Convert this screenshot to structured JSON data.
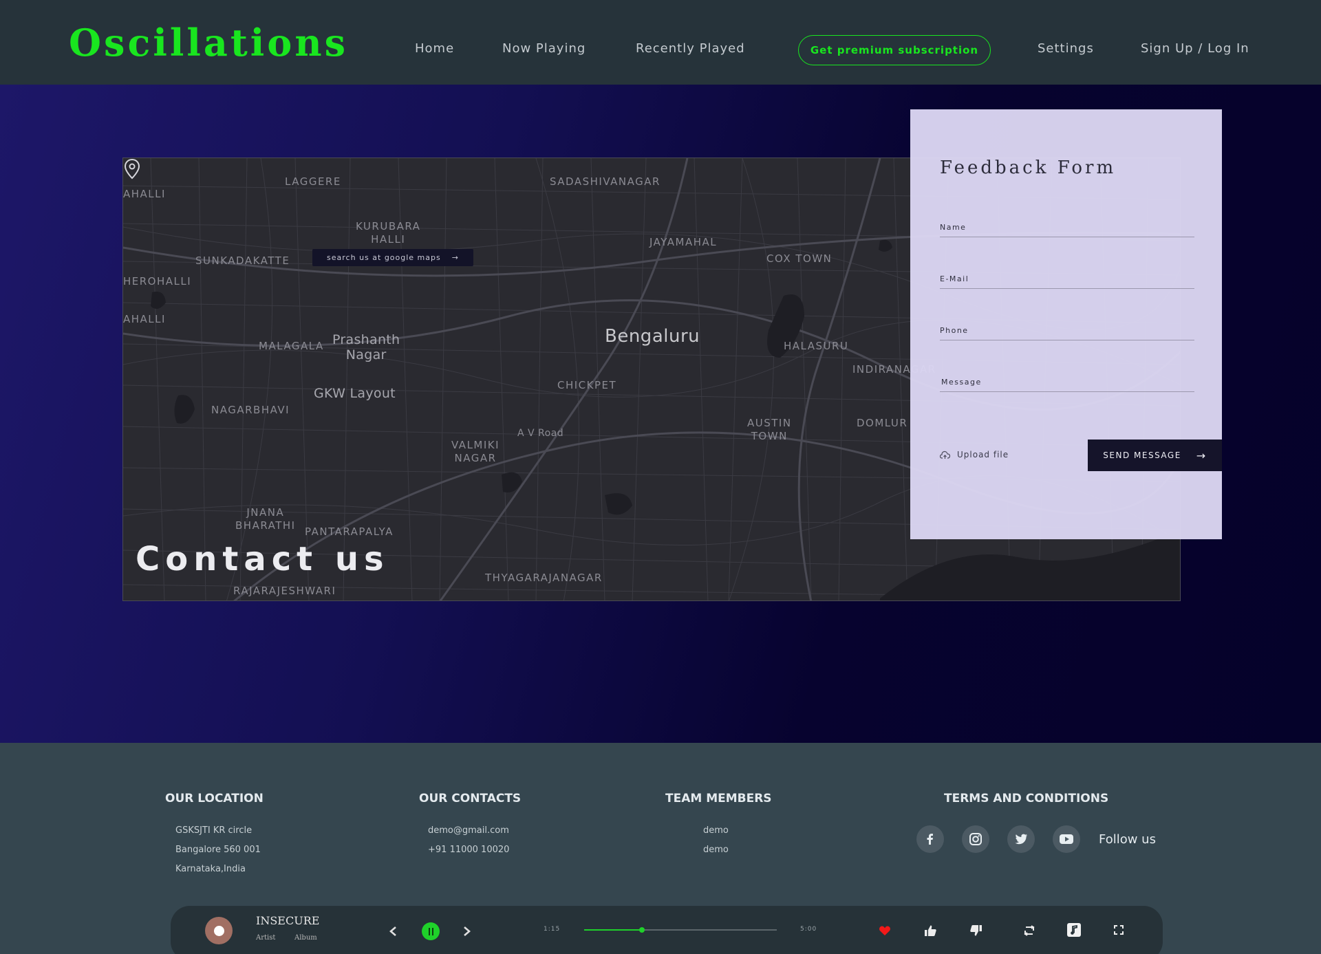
{
  "brand": "Oscillations",
  "nav": {
    "home": "Home",
    "now_playing": "Now Playing",
    "recently_played": "Recently Played",
    "premium": "Get premium subscription",
    "settings": "Settings",
    "auth": "Sign Up / Log In"
  },
  "map": {
    "search_button": "search us at google maps",
    "search_arrow": "→",
    "contact_title": "Contact us",
    "labels": {
      "laggere": "LAGGERE",
      "sadashivanagar": "SADASHIVANAGAR",
      "kurubara": "KURUBARA\nHALLI",
      "sunkadakatte": "SUNKADAKATTE",
      "jayamahal": "JAYAMAHAL",
      "cox_town": "COX TOWN",
      "ahalli1": "AHALLI",
      "herohalli": "HEROHALLI",
      "ahalli2": "AHALLI",
      "malagala": "MALAGALA",
      "prashanth": "Prashanth\nNagar",
      "bengaluru": "Bengaluru",
      "halasuru": "HALASURU",
      "indiranagar": "INDIRANAGAR",
      "chickpet": "CHICKPET",
      "gkw": "GKW Layout",
      "nagarbhavi": "NAGARBHAVI",
      "av_road": "A V Road",
      "valmiki": "VALMIKI\nNAGAR",
      "austin": "AUSTIN\nTOWN",
      "domlur": "DOMLUR",
      "jnana": "JNANA\nBHARATHI",
      "pantarapalya": "PANTARAPALYA",
      "thyagarajanagar": "THYAGARAJANAGAR",
      "rajarajeshwari": "RAJARAJESHWARI"
    }
  },
  "form": {
    "title": "Feedback Form",
    "name": "Name",
    "email": "E-Mail",
    "phone": "Phone",
    "message": "Message",
    "upload": "Upload file",
    "send": "SEND MESSAGE",
    "send_arrow": "→"
  },
  "footer": {
    "location_title": "OUR LOCATION",
    "location_lines": [
      "GSKSJTI KR circle",
      "Bangalore 560 001",
      "Karnataka,India"
    ],
    "contacts_title": "OUR CONTACTS",
    "contact_lines": [
      "demo@gmail.com",
      "+91 11000 10020"
    ],
    "team_title": "TEAM MEMBERS",
    "team_lines": [
      "demo",
      "demo"
    ],
    "terms_title": "TERMS AND CONDITIONS",
    "follow": "Follow us",
    "social_icons": [
      "facebook-icon",
      "instagram-icon",
      "twitter-icon",
      "youtube-icon"
    ]
  },
  "player": {
    "song": "INSECURE",
    "artist": "Artist",
    "album": "Album",
    "current_time": "1:15",
    "total_time": "5:00",
    "progress": 0.3,
    "accent": "#1fd12a",
    "liked": true
  },
  "colors": {
    "brand": "#19e61f",
    "nav_bg": "#26333a",
    "footer_bg": "#35464f",
    "form_bg": "#dcd6f2"
  }
}
